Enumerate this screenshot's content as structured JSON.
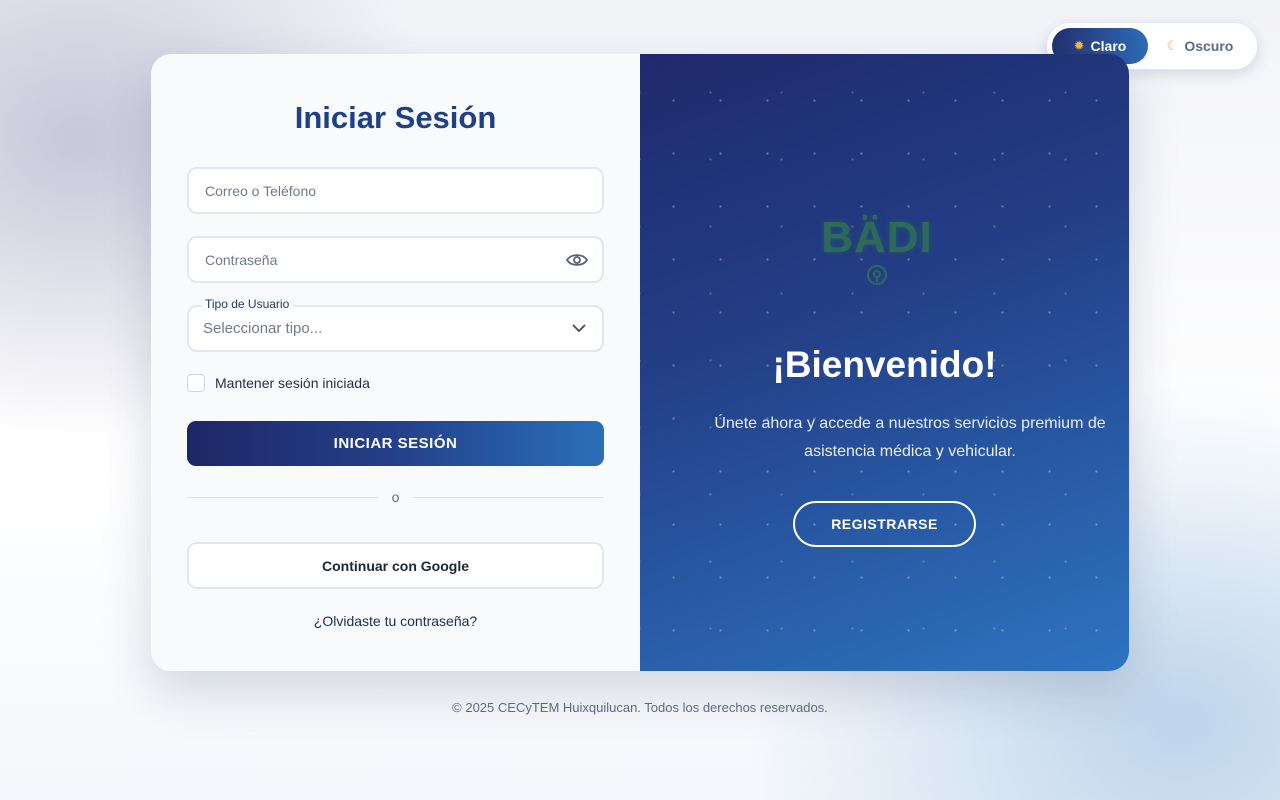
{
  "theme_toggle": {
    "light_label": "Claro",
    "dark_label": "Oscuro",
    "light_icon": "sun-icon",
    "dark_icon": "moon-icon",
    "selected": "Claro"
  },
  "login": {
    "title": "Iniciar Sesión",
    "email_placeholder": "Correo o Teléfono",
    "email_value": "",
    "password_placeholder": "Contraseña",
    "password_value": "",
    "password_toggle_icon": "eye-icon",
    "user_type_label": "Tipo de Usuario",
    "user_type_value": "Seleccionar tipo...",
    "remember_label": "Mantener sesión iniciada",
    "remember_checked": false,
    "submit_label": "INICIAR SESIÓN",
    "divider_text": "o",
    "google_label": "Continuar con Google",
    "forgot_label": "¿Olvidaste tu contraseña?"
  },
  "welcome_panel": {
    "logo_text": "BÄDI",
    "heading": "¡Bienvenido!",
    "subtitle": "Únete ahora y accede a nuestros servicios premium de asistencia médica y vehicular.",
    "register_label": "REGISTRARSE"
  },
  "footer": {
    "text": "© 2025 CECyTEM Huixquilucan. Todos los derechos reservados."
  },
  "colors": {
    "primary_dark": "#1e2766",
    "primary_light": "#2b6fb9",
    "title_blue": "#1f3f86",
    "panel_bg": "#f8fafc"
  }
}
